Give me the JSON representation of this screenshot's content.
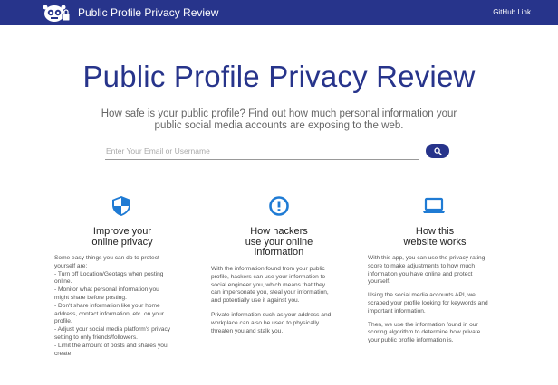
{
  "navbar": {
    "brand": "Public Profile Privacy Review",
    "github_link": "GitHub Link",
    "logo_icon": "privacy-robot-logo"
  },
  "hero": {
    "title": "Public Profile Privacy Review",
    "subtitle": "How safe is your public profile? Find out how much personal information your public social media accounts are exposing to the web."
  },
  "search": {
    "placeholder": "Enter Your Email or Username",
    "value": "",
    "button_icon": "search-icon"
  },
  "columns": [
    {
      "icon": "shield-icon",
      "title_lines": [
        "Improve your",
        "online privacy"
      ],
      "body_lines": [
        "Some easy things you can do to protect",
        "yourself are:",
        "- Turn off Location/Geotags when posting",
        "online.",
        "- Monitor what personal information you",
        "might share before posting.",
        "- Don't share information like your home",
        "address, contact information, etc. on your",
        "profile.",
        "- Adjust your social media platform's privacy",
        "setting to only friends/followers.",
        "- Limit the amount of posts and shares you",
        "create."
      ]
    },
    {
      "icon": "alert-circle-icon",
      "title_lines": [
        "How hackers",
        "use your online",
        "information"
      ],
      "body_lines": [
        "With the information found from your public",
        "profile, hackers can use your information to",
        "social engineer you, which means that they",
        "can impersonate you, steal your information,",
        "and potentially use it against you.",
        "",
        "Private information such as your address and",
        "workplace can also be used to physically",
        "threaten you and stalk you."
      ]
    },
    {
      "icon": "laptop-icon",
      "title_lines": [
        "How this",
        "website works"
      ],
      "body_lines": [
        "With this app, you can use the privacy rating",
        "score to make adjustments to how much",
        "information you have online and protect",
        "yourself.",
        "",
        "Using the social media accounts API, we",
        "scraped your profile looking for keywords and",
        "important information.",
        "",
        "Then, we use the information found in our",
        "scoring algorithm to determine how private",
        "your public profile information is."
      ]
    }
  ],
  "colors": {
    "primary": "#27348b",
    "icon_blue": "#1f7bd4"
  }
}
